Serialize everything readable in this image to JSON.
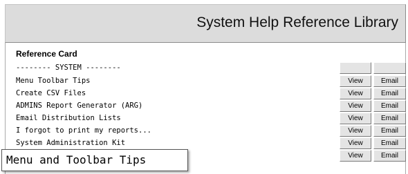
{
  "header": {
    "title": "System Help Reference Library"
  },
  "card": {
    "title": "Reference Card",
    "section_label": "-------- SYSTEM --------",
    "items": [
      {
        "label": "Menu Toolbar Tips",
        "view": "View",
        "email": "Email"
      },
      {
        "label": "Create CSV Files",
        "view": "View",
        "email": "Email"
      },
      {
        "label": "ADMINS Report Generator (ARG)",
        "view": "View",
        "email": "Email"
      },
      {
        "label": "Email Distribution Lists",
        "view": "View",
        "email": "Email"
      },
      {
        "label": "I forgot to print my reports...",
        "view": "View",
        "email": "Email"
      },
      {
        "label": "System Administration Kit",
        "view": "View",
        "email": "Email"
      },
      {
        "label": "",
        "view": "View",
        "email": "Email"
      }
    ]
  },
  "tooltip": {
    "text": "Menu and Toolbar Tips"
  }
}
